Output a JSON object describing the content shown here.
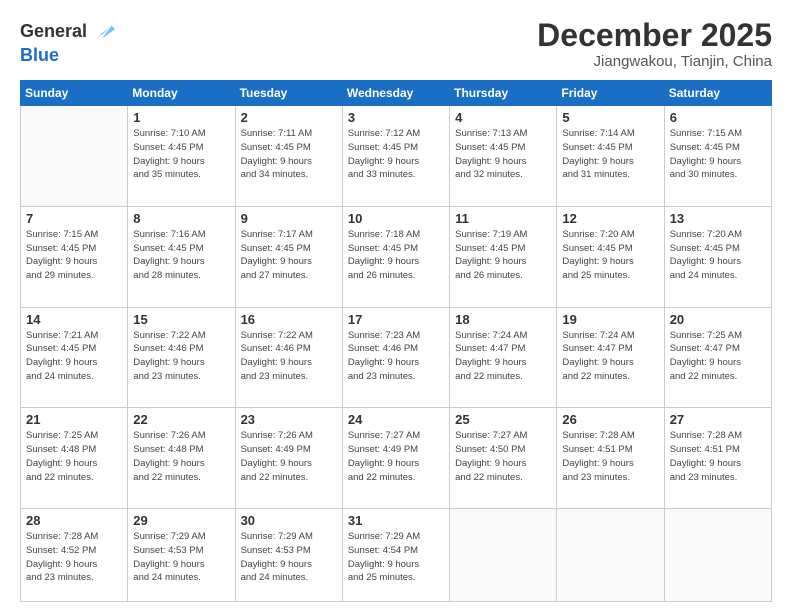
{
  "header": {
    "logo_general": "General",
    "logo_blue": "Blue",
    "month": "December 2025",
    "location": "Jiangwakou, Tianjin, China"
  },
  "weekdays": [
    "Sunday",
    "Monday",
    "Tuesday",
    "Wednesday",
    "Thursday",
    "Friday",
    "Saturday"
  ],
  "weeks": [
    [
      {
        "day": "",
        "info": ""
      },
      {
        "day": "1",
        "info": "Sunrise: 7:10 AM\nSunset: 4:45 PM\nDaylight: 9 hours\nand 35 minutes."
      },
      {
        "day": "2",
        "info": "Sunrise: 7:11 AM\nSunset: 4:45 PM\nDaylight: 9 hours\nand 34 minutes."
      },
      {
        "day": "3",
        "info": "Sunrise: 7:12 AM\nSunset: 4:45 PM\nDaylight: 9 hours\nand 33 minutes."
      },
      {
        "day": "4",
        "info": "Sunrise: 7:13 AM\nSunset: 4:45 PM\nDaylight: 9 hours\nand 32 minutes."
      },
      {
        "day": "5",
        "info": "Sunrise: 7:14 AM\nSunset: 4:45 PM\nDaylight: 9 hours\nand 31 minutes."
      },
      {
        "day": "6",
        "info": "Sunrise: 7:15 AM\nSunset: 4:45 PM\nDaylight: 9 hours\nand 30 minutes."
      }
    ],
    [
      {
        "day": "7",
        "info": "Sunrise: 7:15 AM\nSunset: 4:45 PM\nDaylight: 9 hours\nand 29 minutes."
      },
      {
        "day": "8",
        "info": "Sunrise: 7:16 AM\nSunset: 4:45 PM\nDaylight: 9 hours\nand 28 minutes."
      },
      {
        "day": "9",
        "info": "Sunrise: 7:17 AM\nSunset: 4:45 PM\nDaylight: 9 hours\nand 27 minutes."
      },
      {
        "day": "10",
        "info": "Sunrise: 7:18 AM\nSunset: 4:45 PM\nDaylight: 9 hours\nand 26 minutes."
      },
      {
        "day": "11",
        "info": "Sunrise: 7:19 AM\nSunset: 4:45 PM\nDaylight: 9 hours\nand 26 minutes."
      },
      {
        "day": "12",
        "info": "Sunrise: 7:20 AM\nSunset: 4:45 PM\nDaylight: 9 hours\nand 25 minutes."
      },
      {
        "day": "13",
        "info": "Sunrise: 7:20 AM\nSunset: 4:45 PM\nDaylight: 9 hours\nand 24 minutes."
      }
    ],
    [
      {
        "day": "14",
        "info": "Sunrise: 7:21 AM\nSunset: 4:45 PM\nDaylight: 9 hours\nand 24 minutes."
      },
      {
        "day": "15",
        "info": "Sunrise: 7:22 AM\nSunset: 4:46 PM\nDaylight: 9 hours\nand 23 minutes."
      },
      {
        "day": "16",
        "info": "Sunrise: 7:22 AM\nSunset: 4:46 PM\nDaylight: 9 hours\nand 23 minutes."
      },
      {
        "day": "17",
        "info": "Sunrise: 7:23 AM\nSunset: 4:46 PM\nDaylight: 9 hours\nand 23 minutes."
      },
      {
        "day": "18",
        "info": "Sunrise: 7:24 AM\nSunset: 4:47 PM\nDaylight: 9 hours\nand 22 minutes."
      },
      {
        "day": "19",
        "info": "Sunrise: 7:24 AM\nSunset: 4:47 PM\nDaylight: 9 hours\nand 22 minutes."
      },
      {
        "day": "20",
        "info": "Sunrise: 7:25 AM\nSunset: 4:47 PM\nDaylight: 9 hours\nand 22 minutes."
      }
    ],
    [
      {
        "day": "21",
        "info": "Sunrise: 7:25 AM\nSunset: 4:48 PM\nDaylight: 9 hours\nand 22 minutes."
      },
      {
        "day": "22",
        "info": "Sunrise: 7:26 AM\nSunset: 4:48 PM\nDaylight: 9 hours\nand 22 minutes."
      },
      {
        "day": "23",
        "info": "Sunrise: 7:26 AM\nSunset: 4:49 PM\nDaylight: 9 hours\nand 22 minutes."
      },
      {
        "day": "24",
        "info": "Sunrise: 7:27 AM\nSunset: 4:49 PM\nDaylight: 9 hours\nand 22 minutes."
      },
      {
        "day": "25",
        "info": "Sunrise: 7:27 AM\nSunset: 4:50 PM\nDaylight: 9 hours\nand 22 minutes."
      },
      {
        "day": "26",
        "info": "Sunrise: 7:28 AM\nSunset: 4:51 PM\nDaylight: 9 hours\nand 23 minutes."
      },
      {
        "day": "27",
        "info": "Sunrise: 7:28 AM\nSunset: 4:51 PM\nDaylight: 9 hours\nand 23 minutes."
      }
    ],
    [
      {
        "day": "28",
        "info": "Sunrise: 7:28 AM\nSunset: 4:52 PM\nDaylight: 9 hours\nand 23 minutes."
      },
      {
        "day": "29",
        "info": "Sunrise: 7:29 AM\nSunset: 4:53 PM\nDaylight: 9 hours\nand 24 minutes."
      },
      {
        "day": "30",
        "info": "Sunrise: 7:29 AM\nSunset: 4:53 PM\nDaylight: 9 hours\nand 24 minutes."
      },
      {
        "day": "31",
        "info": "Sunrise: 7:29 AM\nSunset: 4:54 PM\nDaylight: 9 hours\nand 25 minutes."
      },
      {
        "day": "",
        "info": ""
      },
      {
        "day": "",
        "info": ""
      },
      {
        "day": "",
        "info": ""
      }
    ]
  ]
}
